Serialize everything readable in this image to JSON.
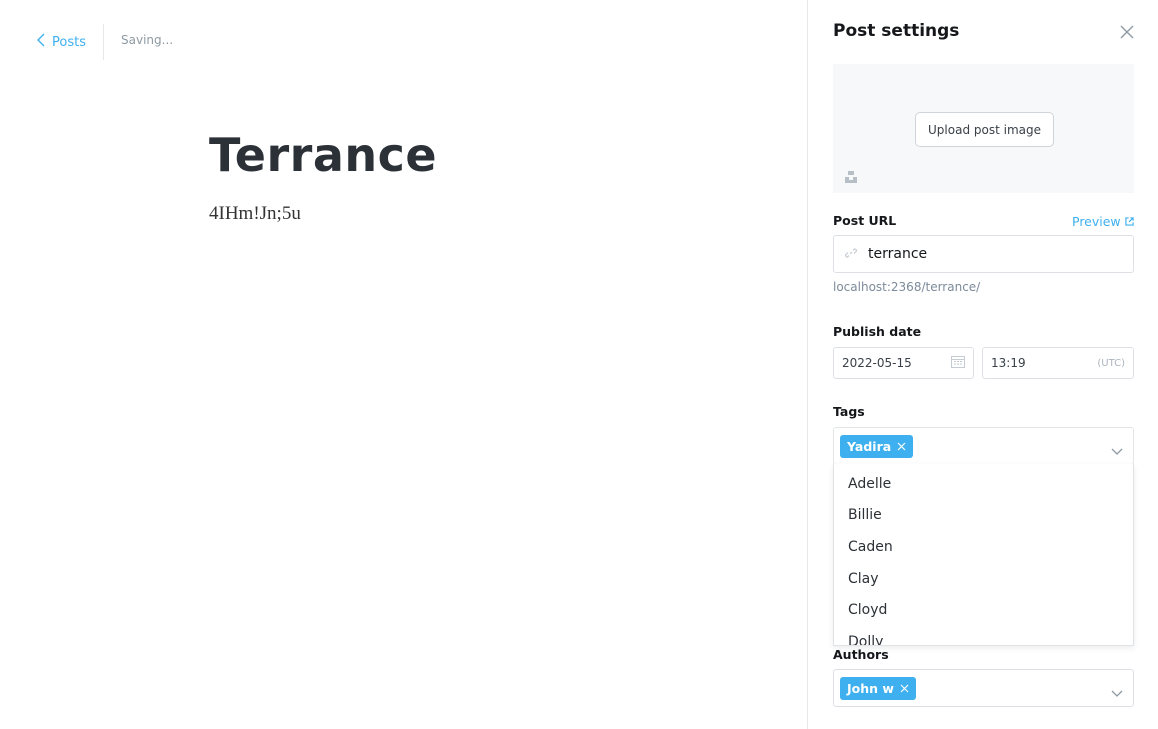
{
  "header": {
    "back_label": "Posts",
    "status": "Saving..."
  },
  "post": {
    "title": "Terrance",
    "body": "4IHm!Jn;5u"
  },
  "settings": {
    "title": "Post settings",
    "upload_label": "Upload post image",
    "url": {
      "label": "Post URL",
      "preview_label": "Preview",
      "value": "terrance",
      "hint": "localhost:2368/terrance/"
    },
    "publish": {
      "label": "Publish date",
      "date": "2022-05-15",
      "time": "13:19",
      "timezone": "(UTC)"
    },
    "tags": {
      "label": "Tags",
      "selected": [
        "Yadira"
      ],
      "options": [
        "Adelle",
        "Billie",
        "Caden",
        "Clay",
        "Cloyd",
        "Dolly"
      ]
    },
    "authors": {
      "label": "Authors",
      "selected": [
        "John w"
      ]
    }
  },
  "colors": {
    "accent": "#3eb0ef",
    "text": "#15171a",
    "muted": "#7c8b9a",
    "border": "#dde1e5"
  },
  "icons": [
    "chevron-left-icon",
    "close-icon",
    "unsplash-icon",
    "link-icon",
    "external-link-icon",
    "calendar-icon",
    "chevron-down-icon"
  ]
}
